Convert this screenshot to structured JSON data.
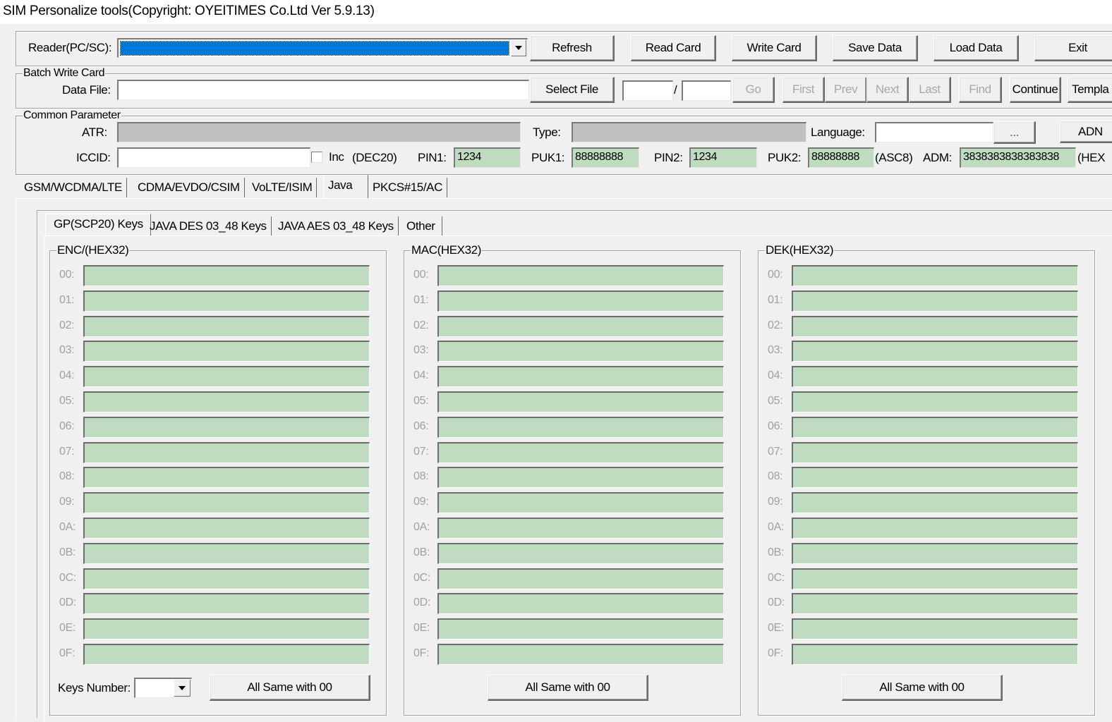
{
  "window": {
    "title": "SIM Personalize tools(Copyright: OYEITIMES Co.Ltd  Ver 5.9.13)"
  },
  "toolbar": {
    "reader_label": "Reader(PC/SC):",
    "reader_value": "",
    "reader_highlight_color": "#0078d7",
    "buttons": {
      "refresh": "Refresh",
      "read_card": "Read Card",
      "write_card": "Write Card",
      "save_data": "Save Data",
      "load_data": "Load Data",
      "exit": "Exit"
    }
  },
  "batch": {
    "group_title": "Batch Write Card",
    "data_file_label": "Data File:",
    "data_file_value": "",
    "select_file": "Select File",
    "page_current": "",
    "page_separator": "/",
    "page_total": "",
    "go": "Go",
    "first": "First",
    "prev": "Prev",
    "next": "Next",
    "last": "Last",
    "find": "Find",
    "continue": "Continue",
    "template": "Templa"
  },
  "common": {
    "group_title": "Common Parameter",
    "atr_label": "ATR:",
    "atr_value": "",
    "type_label": "Type:",
    "type_value": "",
    "language_label": "Language:",
    "language_value": "",
    "browse_button": "...",
    "adn_button": "ADN",
    "iccid_label": "ICCID:",
    "iccid_value": "",
    "inc_label": "Inc",
    "inc_checked": false,
    "dec20_label": "(DEC20)",
    "pin1_label": "PIN1:",
    "pin1_value": "1234",
    "puk1_label": "PUK1:",
    "puk1_value": "88888888",
    "pin2_label": "PIN2:",
    "pin2_value": "1234",
    "puk2_label": "PUK2:",
    "puk2_value": "88888888",
    "asc8_label": "(ASC8)",
    "adm_label": "ADM:",
    "adm_value": "3838383838383838",
    "hex_label": "(HEX"
  },
  "main_tabs": [
    {
      "label": "GSM/WCDMA/LTE",
      "active": false
    },
    {
      "label": "CDMA/EVDO/CSIM",
      "active": false
    },
    {
      "label": "VoLTE/ISIM",
      "active": false
    },
    {
      "label": "Java",
      "active": true
    },
    {
      "label": "PKCS#15/AC",
      "active": false
    }
  ],
  "sub_tabs": [
    {
      "label": "GP(SCP20) Keys",
      "active": true
    },
    {
      "label": "JAVA DES 03_48 Keys",
      "active": false
    },
    {
      "label": "JAVA AES 03_48 Keys",
      "active": false
    },
    {
      "label": "Other",
      "active": false
    }
  ],
  "key_groups": [
    {
      "title": "ENC/(HEX32)",
      "rows": [
        {
          "label": "00:",
          "value": ""
        },
        {
          "label": "01:",
          "value": ""
        },
        {
          "label": "02:",
          "value": ""
        },
        {
          "label": "03:",
          "value": ""
        },
        {
          "label": "04:",
          "value": ""
        },
        {
          "label": "05:",
          "value": ""
        },
        {
          "label": "06:",
          "value": ""
        },
        {
          "label": "07:",
          "value": ""
        },
        {
          "label": "08:",
          "value": ""
        },
        {
          "label": "09:",
          "value": ""
        },
        {
          "label": "0A:",
          "value": ""
        },
        {
          "label": "0B:",
          "value": ""
        },
        {
          "label": "0C:",
          "value": ""
        },
        {
          "label": "0D:",
          "value": ""
        },
        {
          "label": "0E:",
          "value": ""
        },
        {
          "label": "0F:",
          "value": ""
        }
      ],
      "button": "All Same with 00"
    },
    {
      "title": "MAC(HEX32)",
      "rows": [
        {
          "label": "00:",
          "value": ""
        },
        {
          "label": "01:",
          "value": ""
        },
        {
          "label": "02:",
          "value": ""
        },
        {
          "label": "03:",
          "value": ""
        },
        {
          "label": "04:",
          "value": ""
        },
        {
          "label": "05:",
          "value": ""
        },
        {
          "label": "06:",
          "value": ""
        },
        {
          "label": "07:",
          "value": ""
        },
        {
          "label": "08:",
          "value": ""
        },
        {
          "label": "09:",
          "value": ""
        },
        {
          "label": "0A:",
          "value": ""
        },
        {
          "label": "0B:",
          "value": ""
        },
        {
          "label": "0C:",
          "value": ""
        },
        {
          "label": "0D:",
          "value": ""
        },
        {
          "label": "0E:",
          "value": ""
        },
        {
          "label": "0F:",
          "value": ""
        }
      ],
      "button": "All Same with 00"
    },
    {
      "title": "DEK(HEX32)",
      "rows": [
        {
          "label": "00:",
          "value": ""
        },
        {
          "label": "01:",
          "value": ""
        },
        {
          "label": "02:",
          "value": ""
        },
        {
          "label": "03:",
          "value": ""
        },
        {
          "label": "04:",
          "value": ""
        },
        {
          "label": "05:",
          "value": ""
        },
        {
          "label": "06:",
          "value": ""
        },
        {
          "label": "07:",
          "value": ""
        },
        {
          "label": "08:",
          "value": ""
        },
        {
          "label": "09:",
          "value": ""
        },
        {
          "label": "0A:",
          "value": ""
        },
        {
          "label": "0B:",
          "value": ""
        },
        {
          "label": "0C:",
          "value": ""
        },
        {
          "label": "0D:",
          "value": ""
        },
        {
          "label": "0E:",
          "value": ""
        },
        {
          "label": "0F:",
          "value": ""
        }
      ],
      "button": "All Same with 00"
    }
  ],
  "keys_number": {
    "label": "Keys Number:",
    "value": ""
  },
  "colors": {
    "key_field_bg": "#c0dcc0",
    "readonly_field_bg": "#c0c0c0",
    "window_bg": "#f0f0f0"
  }
}
